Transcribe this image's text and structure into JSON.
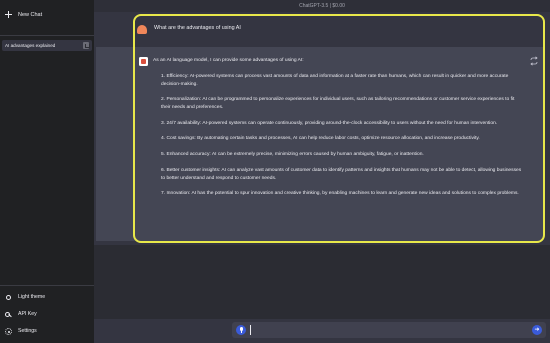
{
  "window": {
    "title": "ChatGPT-3.5 | $0.00"
  },
  "sidebar": {
    "new_chat_label": "New Chat",
    "conversations": [
      {
        "label": "AI advantages explained"
      }
    ],
    "bottom": [
      {
        "label": "Light theme",
        "icon": "sun-icon"
      },
      {
        "label": "API Key",
        "icon": "key-icon"
      },
      {
        "label": "Settings",
        "icon": "gear-icon"
      }
    ]
  },
  "chat": {
    "user_message": "What are the advantages of using AI",
    "assistant_intro": "As an AI language model, I can provide some advantages of using AI:",
    "assistant_points": [
      "1. Efficiency: AI-powered systems can process vast amounts of data and information at a faster rate than humans, which can result in quicker and more accurate decision-making.",
      "2. Personalization: AI can be programmed to personalize experiences for individual users, such as tailoring recommendations or customer service experiences to fit their needs and preferences.",
      "3. 24/7 availability: AI-powered systems can operate continuously, providing around-the-clock accessibility to users without the need for human intervention.",
      "4. Cost savings: By automating certain tasks and processes, AI can help reduce labor costs, optimize resource allocation, and increase productivity.",
      "5. Enhanced accuracy: AI can be extremely precise, minimizing errors caused by human ambiguity, fatigue, or inattention.",
      "6. Better customer insights: AI can analyze vast amounts of customer data to identify patterns and insights that humans may not be able to detect, allowing businesses to better understand and respond to customer needs.",
      "7. Innovation: AI has the potential to spur innovation and creative thinking, by enabling machines to learn and generate new ideas and solutions to complex problems."
    ]
  },
  "input": {
    "value": "",
    "placeholder": ""
  },
  "colors": {
    "sidebar_bg": "#202123",
    "main_bg": "#343541",
    "assistant_bg": "#444654",
    "highlight": "#e8e84a",
    "accent": "#3a5bd9"
  }
}
